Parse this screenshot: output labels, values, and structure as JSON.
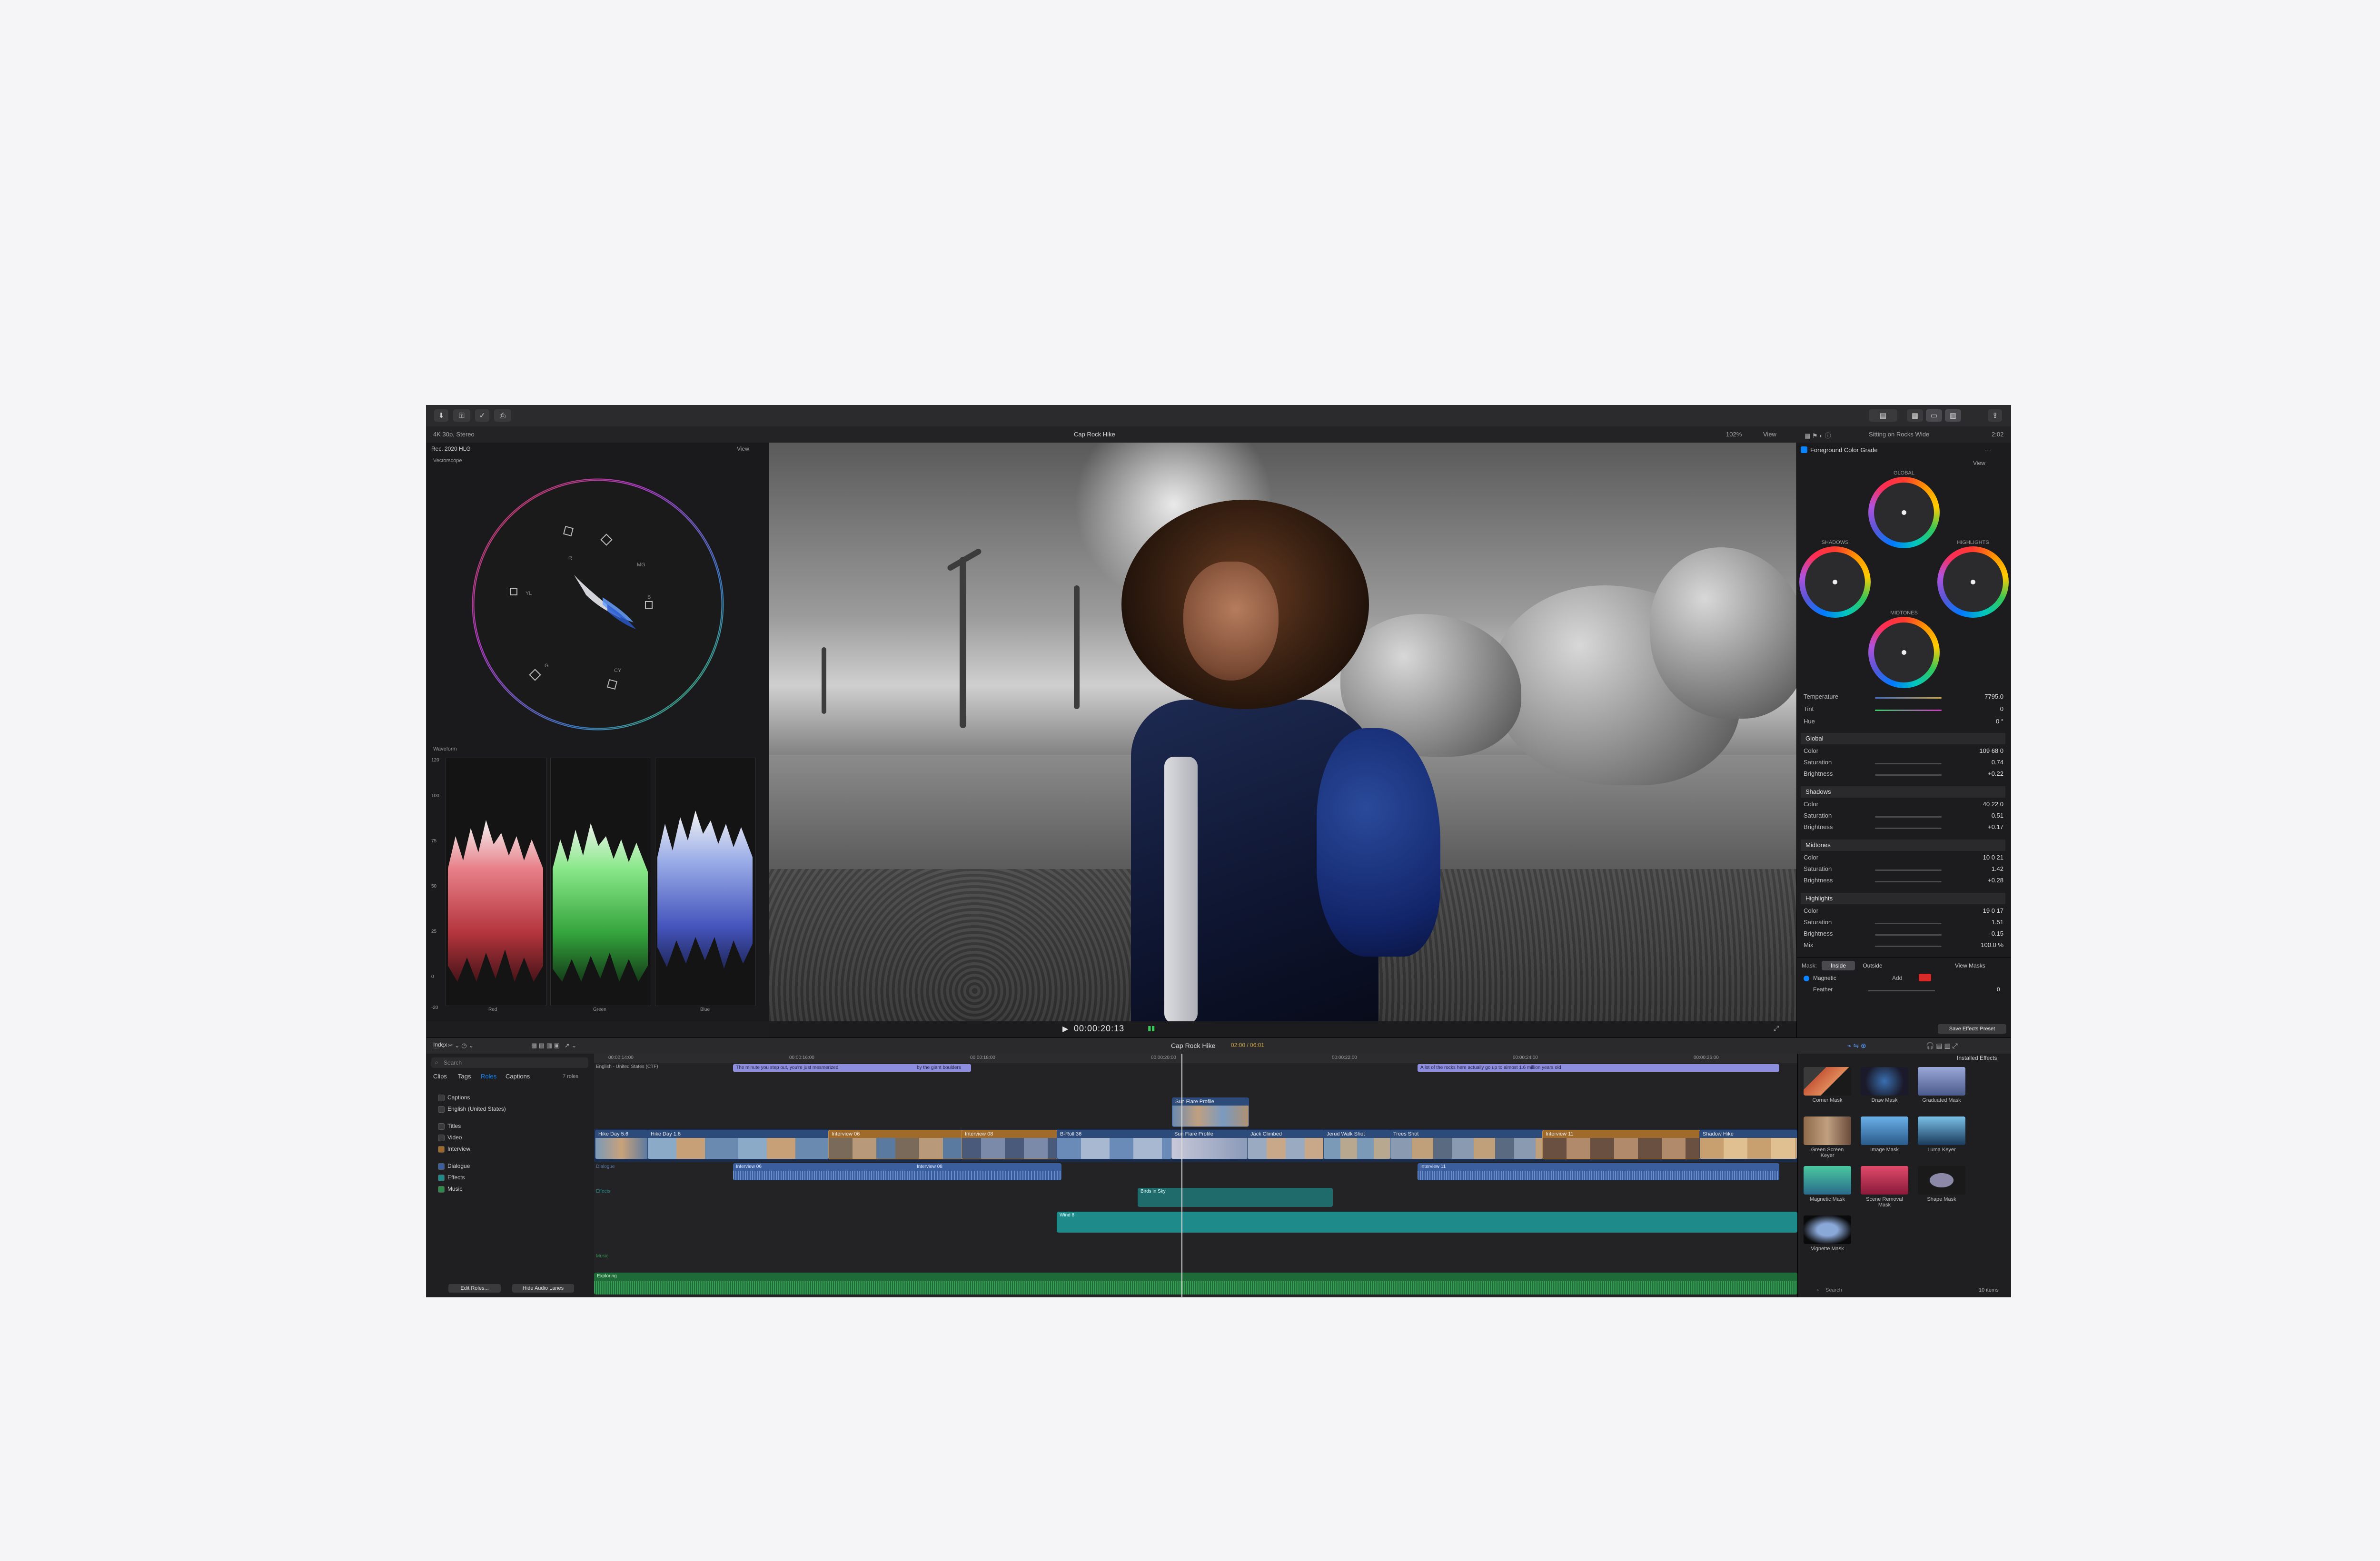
{
  "app": {
    "project_format": "4K 30p, Stereo",
    "viewer_title": "Cap Rock Hike",
    "zoom": "102%",
    "view_label": "View",
    "inspector_clip": "Sitting on Rocks Wide",
    "inspector_duration": "2:02"
  },
  "scopes": {
    "header": "Rec. 2020 HLG",
    "view_label": "View",
    "vectorscope_label": "Vectorscope",
    "vector_targets": [
      "R",
      "MG",
      "B",
      "CY",
      "G",
      "YL"
    ],
    "waveform_label": "Waveform",
    "waveform_scale": [
      "120",
      "100",
      "75",
      "50",
      "25",
      "0",
      "-20"
    ],
    "waveform_channels": [
      "Red",
      "Green",
      "Blue"
    ]
  },
  "transport": {
    "timecode": "00:00:20:13"
  },
  "inspector": {
    "effect_name": "Foreground Color Grade",
    "view_label": "View",
    "wheels": {
      "global": "GLOBAL",
      "shadows": "SHADOWS",
      "highlights": "HIGHLIGHTS",
      "midtones": "MIDTONES"
    },
    "top_rows": [
      {
        "label": "Temperature",
        "value": "7795.0"
      },
      {
        "label": "Tint",
        "value": "0"
      },
      {
        "label": "Hue",
        "value": "0 °"
      }
    ],
    "sections": [
      {
        "name": "Global",
        "rows": [
          {
            "label": "Color",
            "value": "109  68  0"
          },
          {
            "label": "Saturation",
            "value": "0.74"
          },
          {
            "label": "Brightness",
            "value": "+0.22"
          }
        ]
      },
      {
        "name": "Shadows",
        "rows": [
          {
            "label": "Color",
            "value": "40  22  0"
          },
          {
            "label": "Saturation",
            "value": "0.51"
          },
          {
            "label": "Brightness",
            "value": "+0.17"
          }
        ]
      },
      {
        "name": "Midtones",
        "rows": [
          {
            "label": "Color",
            "value": "10  0  21"
          },
          {
            "label": "Saturation",
            "value": "1.42"
          },
          {
            "label": "Brightness",
            "value": "+0.28"
          }
        ]
      },
      {
        "name": "Highlights",
        "rows": [
          {
            "label": "Color",
            "value": "19  0  17"
          },
          {
            "label": "Saturation",
            "value": "1.51"
          },
          {
            "label": "Brightness",
            "value": "-0.15"
          },
          {
            "label": "Mix",
            "value": "100.0 %"
          }
        ]
      }
    ],
    "mask_label": "Mask:",
    "mask_inside": "Inside",
    "mask_outside": "Outside",
    "view_masks": "View Masks",
    "magnetic_label": "Magnetic",
    "magnetic_add": "Add",
    "feather_label": "Feather",
    "feather_value": "0",
    "save_preset": "Save Effects Preset"
  },
  "timeline": {
    "index_tab": "Index",
    "title": "Cap Rock Hike",
    "duration": "02:00 / 06:01",
    "ruler": [
      "00:00:14:00",
      "00:00:16:00",
      "00:00:18:00",
      "00:00:20:00",
      "00:00:22:00",
      "00:00:24:00",
      "00:00:26:00"
    ],
    "caption_track": "English - United States (CTF)",
    "captions": [
      "The minute you step out, you're just mesmerized",
      "by the giant boulders",
      "A lot of the rocks here actually go up to almost 1.6 million years old"
    ],
    "connected_top": "Sun Flare Profile",
    "primary_clips": [
      "Hike Day 5.6",
      "Hike Day 1.6",
      "Interview 06",
      "Interview 08",
      "B-Roll 36",
      "Sun Flare Profile",
      "Jack Climbed",
      "Jerud Walk Shot",
      "Trees Shot",
      "Interview 11",
      "Shadow Hike"
    ],
    "dialogue_clips": [
      "Interview 06",
      "Interview 08",
      "Interview 11"
    ],
    "effects_label": "Effects",
    "effects_clip": "Birds in Sky",
    "effects_clip2": "Wind 8",
    "music_label": "Music",
    "music_clip": "Exploring"
  },
  "index": {
    "search_placeholder": "Search",
    "tabs": [
      "Clips",
      "Tags",
      "Roles",
      "Captions"
    ],
    "active_tab": "Roles",
    "count": "7 roles",
    "roles": [
      {
        "name": "Captions",
        "group": "captions"
      },
      {
        "name": "English (United States)",
        "group": "captions"
      },
      {
        "name": "Titles",
        "group": "video"
      },
      {
        "name": "Video",
        "group": "video"
      },
      {
        "name": "Interview",
        "group": "video"
      },
      {
        "name": "Dialogue",
        "group": "audio"
      },
      {
        "name": "Effects",
        "group": "audio"
      },
      {
        "name": "Music",
        "group": "audio"
      }
    ],
    "edit_roles": "Edit Roles...",
    "hide_audio": "Hide Audio Lanes"
  },
  "browser": {
    "title": "Installed Effects",
    "search_placeholder": "Search",
    "count": "10 items",
    "effects": [
      {
        "name": "Corner Mask",
        "color": "#c85a3a"
      },
      {
        "name": "Draw Mask",
        "color": "#3a6fb0"
      },
      {
        "name": "Graduated Mask",
        "color": "#6a89c8"
      },
      {
        "name": "Green Screen Keyer",
        "color": "#8f6a4a"
      },
      {
        "name": "Image Mask",
        "color": "#4a90c8"
      },
      {
        "name": "Luma Keyer",
        "color": "#3a5f8a"
      },
      {
        "name": "Magnetic Mask",
        "color": "#3aa86a"
      },
      {
        "name": "Scene Removal Mask",
        "color": "#c83a5a"
      },
      {
        "name": "Shape Mask",
        "color": "#6a6a8a"
      },
      {
        "name": "Vignette Mask",
        "color": "#4a6a9a"
      }
    ]
  },
  "colors": {
    "accent": "#0a84ff",
    "caption": "#8e8ee0",
    "clip_primary": "#2c4a7a",
    "clip_interview": "#a06a2a",
    "dialogue": "#3b5f9e",
    "effects_audio": "#1f8a8a",
    "music": "#2e8a4a"
  }
}
